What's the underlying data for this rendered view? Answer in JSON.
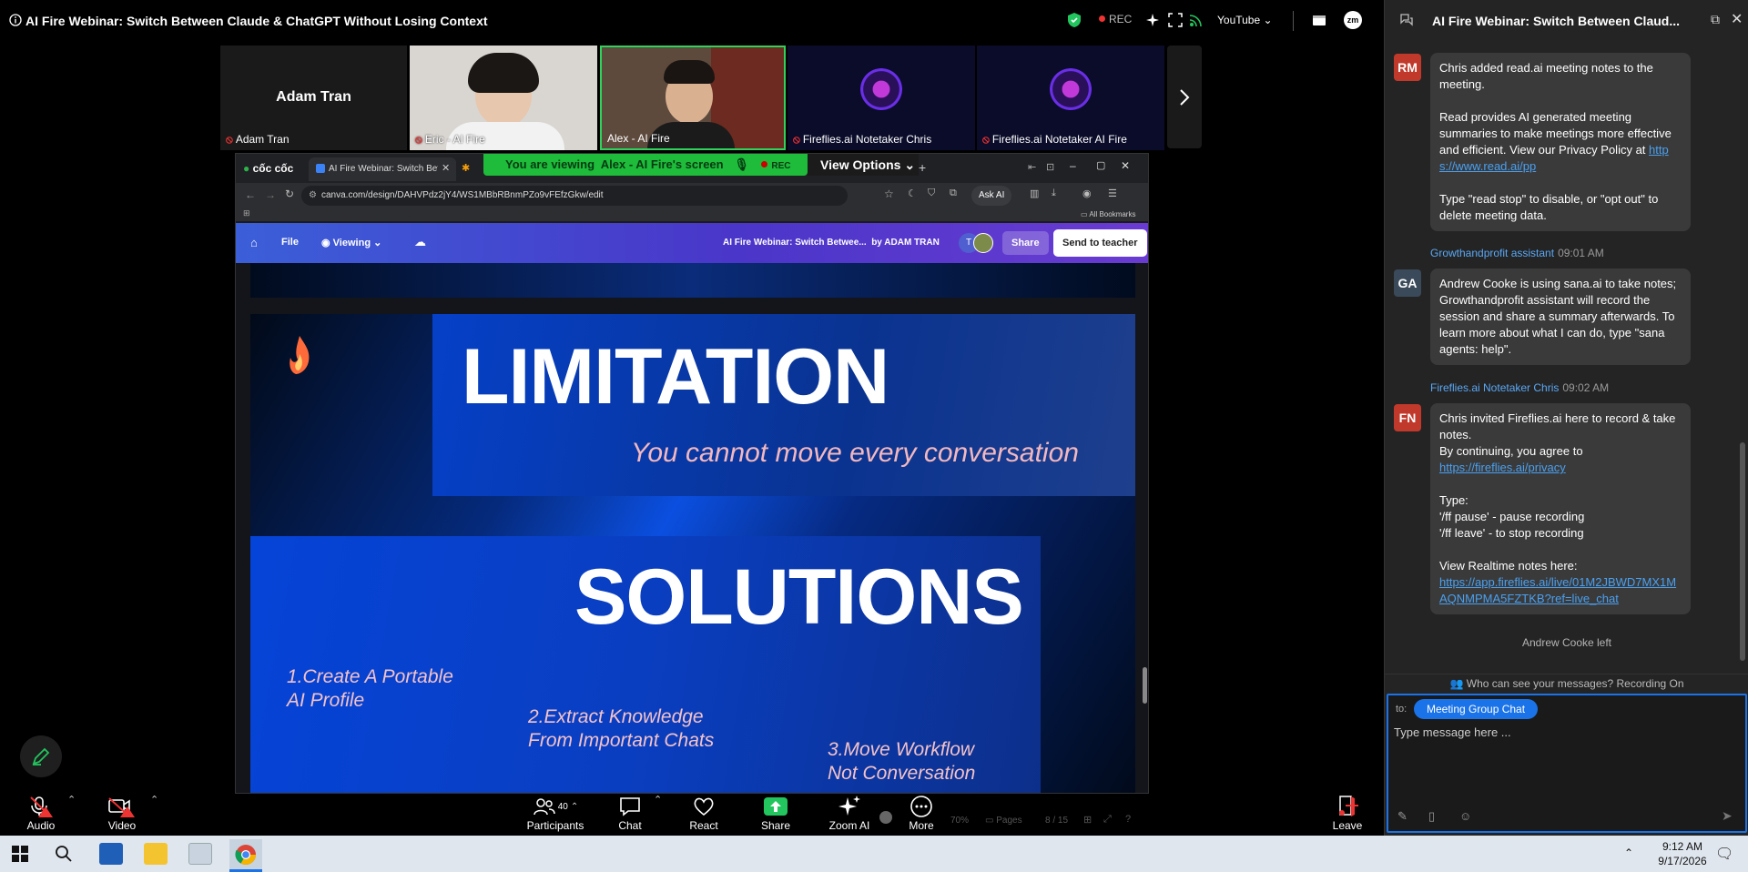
{
  "meeting": {
    "title": "AI Fire Webinar: Switch Between Claude & ChatGPT Without Losing Context",
    "rec_label": "REC",
    "youtube_label": "YouTube"
  },
  "participants": [
    {
      "name": "Adam Tran",
      "display": "Adam Tran"
    },
    {
      "name": "Eric - AI Fire"
    },
    {
      "name": "Alex - AI Fire"
    },
    {
      "name": "Fireflies.ai Notetaker Chris"
    },
    {
      "name": "Fireflies.ai Notetaker AI Fire"
    }
  ],
  "share": {
    "banner_prefix": "You are viewing",
    "banner_name": "Alex - AI Fire's screen",
    "banner_rec": "REC",
    "view_options": "View Options"
  },
  "browser": {
    "brand": "cốc cốc",
    "tab_title": "AI Fire Webinar: Switch Betw",
    "url": "canva.com/design/DAHVPdz2jY4/WS1MBbRBnmPZo9vFEfzGkw/edit",
    "ask_ai": "Ask AI",
    "all_bookmarks": "All Bookmarks"
  },
  "canva": {
    "file": "File",
    "viewing": "Viewing",
    "doc_title": "AI Fire Webinar: Switch Betwee...",
    "by": "by ADAM TRAN",
    "share": "Share",
    "send": "Send to teacher",
    "avatar_initial": "T"
  },
  "slide": {
    "title1": "LIMITATION",
    "subtitle1": "You cannot move every conversation",
    "title2": "SOLUTIONS",
    "item1_line1": "1.Create A Portable",
    "item1_line2": "AI Profile",
    "item2_line1": "2.Extract Knowledge",
    "item2_line2": "From Important Chats",
    "item3_line1": "3.Move Workflow",
    "item3_line2": "Not Conversation"
  },
  "toolbar": {
    "audio": "Audio",
    "video": "Video",
    "participants": "Participants",
    "participants_count": "40",
    "chat": "Chat",
    "react": "React",
    "share": "Share",
    "zoom_ai": "Zoom AI",
    "more": "More",
    "leave": "Leave",
    "zoom_pct": "70%",
    "pages": "Pages",
    "page_count": "8 / 15"
  },
  "chat": {
    "title": "AI Fire Webinar: Switch Between Claud...",
    "messages": [
      {
        "initials": "RM",
        "color": "#c0392b",
        "p1": "Chris added read.ai meeting notes to the meeting.",
        "p2": "Read provides AI generated meeting summaries to make meetings more effective and efficient. View our Privacy Policy at",
        "link": "https://www.read.ai/pp",
        "p3": "Type \"read stop\" to disable, or \"opt out\" to delete meeting data."
      },
      {
        "sender": "Growthandprofit assistant",
        "time": "09:01 AM",
        "initials": "GA",
        "color": "#3a4a5a",
        "text": "Andrew Cooke is using sana.ai to take notes; Growthandprofit assistant will record the session and share a summary afterwards. To learn more about what I can do, type \"sana agents: help\"."
      },
      {
        "sender": "Fireflies.ai Notetaker Chris",
        "time": "09:02 AM",
        "initials": "FN",
        "color": "#c0392b",
        "l1": "Chris invited Fireflies.ai here to record & take notes.",
        "l2": "By continuing, you agree to",
        "link1": "https://fireflies.ai/privacy",
        "l3": "Type:",
        "l4": "'/ff pause' - pause recording",
        "l5": "'/ff leave' - to stop recording",
        "l6": "View Realtime notes here:",
        "link2": "https://app.fireflies.ai/live/01M2JBWD7MX1MAQNMPMA5FZTKB?ref=live_chat"
      }
    ],
    "system": "Andrew Cooke left",
    "who_can_see": "Who can see your messages? Recording On",
    "to_label": "to:",
    "to_target": "Meeting Group Chat",
    "placeholder": "Type message here ..."
  },
  "taskbar": {
    "time": "9:12 AM",
    "date": "9/17/2026"
  },
  "colors": {
    "accent": "#1a73e8",
    "rec": "#e33333",
    "share_green": "#1ebc3a"
  }
}
